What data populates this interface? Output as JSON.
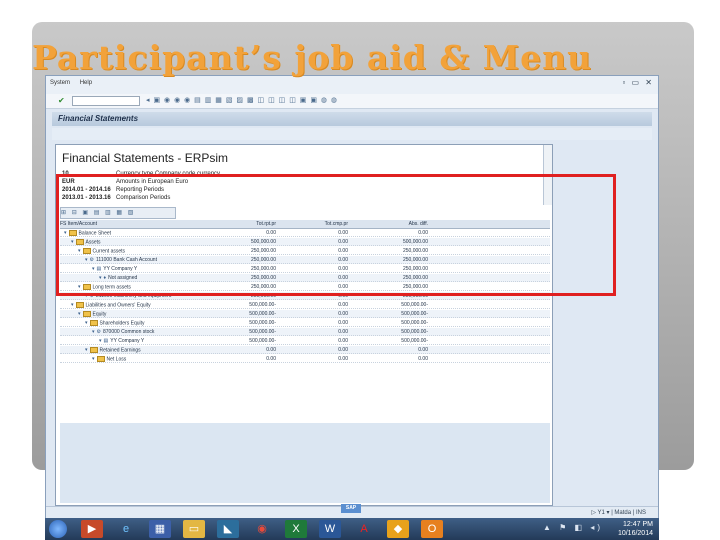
{
  "slide": {
    "title": "Participant’s job aid & Menu"
  },
  "window": {
    "menu": [
      "System",
      "Help"
    ],
    "controls": "▫ ▭ ✕",
    "command_field": ""
  },
  "header": {
    "title": "Financial Statements"
  },
  "report": {
    "title": "Financial Statements - ERPsim",
    "header_lines": [
      {
        "key": "10",
        "value": "Currency type Company code currency"
      },
      {
        "key": "EUR",
        "value": "Amounts in European Euro"
      },
      {
        "key": "2014.01 - 2014.16",
        "value": "Reporting Periods"
      },
      {
        "key": "2013.01 - 2013.16",
        "value": "Comparison Periods"
      }
    ],
    "columns": [
      "FS Item/Account",
      "Tot.rpt.pr",
      "Tot.cmp.pr",
      "Abs. diff."
    ],
    "rows": [
      {
        "level": 0,
        "icon": "folder",
        "name": "Balance Sheet",
        "v1": "0.00",
        "v2": "0.00",
        "v3": "0.00"
      },
      {
        "level": 1,
        "icon": "folder",
        "name": "Assets",
        "v1": "500,000.00",
        "v2": "0.00",
        "v3": "500,000.00"
      },
      {
        "level": 2,
        "icon": "folder",
        "name": "Current assets",
        "v1": "250,000.00",
        "v2": "0.00",
        "v3": "250,000.00"
      },
      {
        "level": 3,
        "icon": "account",
        "name": "111000 Bank Cash Account",
        "v1": "250,000.00",
        "v2": "0.00",
        "v3": "250,000.00"
      },
      {
        "level": 4,
        "icon": "company",
        "name": "YY Company Y",
        "v1": "250,000.00",
        "v2": "0.00",
        "v3": "250,000.00"
      },
      {
        "level": 5,
        "icon": "partner",
        "name": "Not assigned",
        "v1": "250,000.00",
        "v2": "0.00",
        "v3": "250,000.00"
      },
      {
        "level": 2,
        "icon": "folder",
        "name": "Long term assets",
        "v1": "250,000.00",
        "v2": "0.00",
        "v3": "250,000.00"
      },
      {
        "level": 3,
        "icon": "account",
        "name": "211000 Machinery and equipment",
        "v1": "250,000.00",
        "v2": "0.00",
        "v3": "250,000.00"
      },
      {
        "level": 1,
        "icon": "folder",
        "name": "Liabilities and Owners' Equity",
        "v1": "500,000.00-",
        "v2": "0.00",
        "v3": "500,000.00-"
      },
      {
        "level": 2,
        "icon": "folder",
        "name": "Equity",
        "v1": "500,000.00-",
        "v2": "0.00",
        "v3": "500,000.00-"
      },
      {
        "level": 3,
        "icon": "folder",
        "name": "Shareholders Equity",
        "v1": "500,000.00-",
        "v2": "0.00",
        "v3": "500,000.00-"
      },
      {
        "level": 4,
        "icon": "account",
        "name": "870000 Common stock",
        "v1": "500,000.00-",
        "v2": "0.00",
        "v3": "500,000.00-"
      },
      {
        "level": 5,
        "icon": "company",
        "name": "YY Company Y",
        "v1": "500,000.00-",
        "v2": "0.00",
        "v3": "500,000.00-"
      },
      {
        "level": 3,
        "icon": "folder",
        "name": "Retained Earnings",
        "v1": "0.00",
        "v2": "0.00",
        "v3": "0.00"
      },
      {
        "level": 4,
        "icon": "folder",
        "name": "Net Loss",
        "v1": "0.00",
        "v2": "0.00",
        "v3": "0.00"
      }
    ]
  },
  "status": {
    "right_text": "▷ Y1 ▾ | Matda | INS"
  },
  "sap_logo": "SAP",
  "taskbar": {
    "clock_time": "12:47 PM",
    "clock_date": "10/16/2014",
    "tray": "▲ ⚑ ◧ ◂)"
  },
  "colors": {
    "highlight": "#e02020",
    "title": "#f2a23a"
  }
}
